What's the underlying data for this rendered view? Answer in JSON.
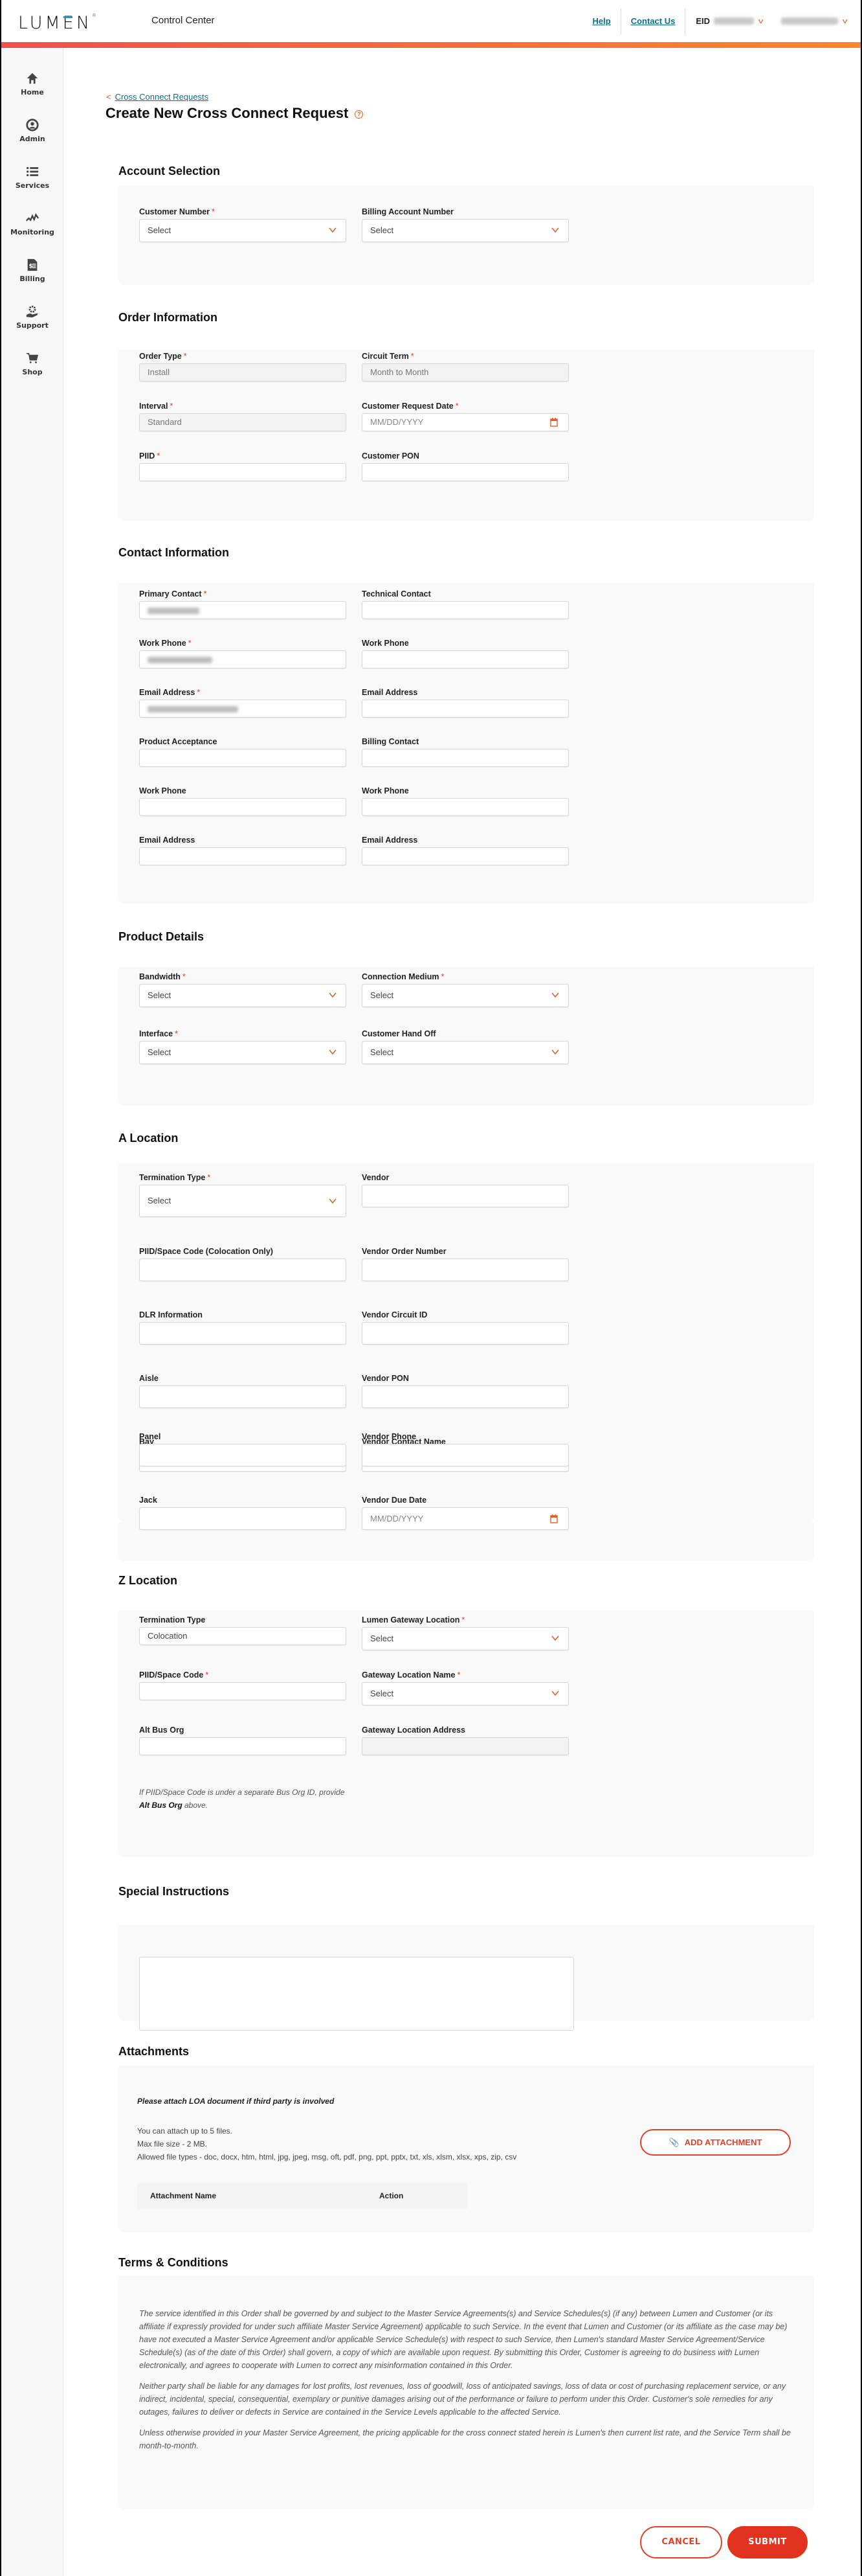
{
  "header": {
    "logo": "LUMEN",
    "app_title": "Control Center",
    "links": [
      "Help",
      "Contact Us"
    ],
    "eid_label": "EID"
  },
  "colors": {
    "accent": "#e0602b",
    "brand_red": "#e0321e",
    "link": "#0c6f8a",
    "panel_bg": "#f9f9f9"
  },
  "sidebar": {
    "items": [
      {
        "label": "Home",
        "icon": "home-icon"
      },
      {
        "label": "Admin",
        "icon": "user-circle-icon"
      },
      {
        "label": "Services",
        "icon": "list-icon"
      },
      {
        "label": "Monitoring",
        "icon": "pulse-icon"
      },
      {
        "label": "Billing",
        "icon": "invoice-icon"
      },
      {
        "label": "Support",
        "icon": "support-gear-hand-icon"
      },
      {
        "label": "Shop",
        "icon": "cart-icon"
      }
    ]
  },
  "breadcrumb": {
    "label": "Cross Connect Requests"
  },
  "page_title": "Create New Cross Connect Request",
  "sections": {
    "account": {
      "title": "Account Selection",
      "customer_number": {
        "label": "Customer Number",
        "value": "Select"
      },
      "billing_account": {
        "label": "Billing Account Number",
        "value": "Select"
      }
    },
    "order": {
      "title": "Order Information",
      "order_type": {
        "label": "Order Type",
        "value": "Install"
      },
      "circuit_term": {
        "label": "Circuit Term",
        "value": "Month to Month"
      },
      "interval": {
        "label": "Interval",
        "value": "Standard"
      },
      "request_date": {
        "label": "Customer Request Date",
        "placeholder": "MM/DD/YYYY"
      },
      "piid": {
        "label": "PIID",
        "value": ""
      },
      "customer_pon": {
        "label": "Customer PON",
        "value": ""
      }
    },
    "contact": {
      "title": "Contact Information",
      "primary_contact": {
        "label": "Primary Contact"
      },
      "technical_contact": {
        "label": "Technical Contact"
      },
      "work_phone_1": {
        "label": "Work Phone"
      },
      "work_phone_2": {
        "label": "Work Phone"
      },
      "email_1": {
        "label": "Email Address"
      },
      "email_2": {
        "label": "Email Address"
      },
      "product_acceptance": {
        "label": "Product Acceptance"
      },
      "billing_contact": {
        "label": "Billing Contact"
      },
      "work_phone_3": {
        "label": "Work Phone"
      },
      "work_phone_4": {
        "label": "Work Phone"
      },
      "email_3": {
        "label": "Email Address"
      },
      "email_4": {
        "label": "Email Address"
      }
    },
    "product": {
      "title": "Product Details",
      "bandwidth": {
        "label": "Bandwidth",
        "value": "Select"
      },
      "connection_medium": {
        "label": "Connection Medium",
        "value": "Select"
      },
      "interface": {
        "label": "Interface",
        "value": "Select"
      },
      "hand_off": {
        "label": "Customer Hand Off",
        "value": "Select"
      }
    },
    "a_location": {
      "title": "A Location",
      "termination_type": {
        "label": "Termination Type",
        "value": "Select"
      },
      "vendor": {
        "label": "Vendor"
      },
      "piid_space": {
        "label": "PIID/Space Code (Colocation Only)"
      },
      "vendor_order": {
        "label": "Vendor Order Number"
      },
      "dlr": {
        "label": "DLR Information"
      },
      "vendor_circuit": {
        "label": "Vendor Circuit ID"
      },
      "aisle": {
        "label": "Aisle"
      },
      "vendor_pon": {
        "label": "Vendor PON"
      },
      "bay": {
        "label": "Bay"
      },
      "vendor_contact": {
        "label": "Vendor Contact Name"
      },
      "panel": {
        "label": "Panel"
      },
      "vendor_phone": {
        "label": "Vendor Phone"
      },
      "jack": {
        "label": "Jack"
      },
      "vendor_due": {
        "label": "Vendor Due Date",
        "placeholder": "MM/DD/YYYY"
      }
    },
    "z_location": {
      "title": "Z Location",
      "termination_type": {
        "label": "Termination Type",
        "value": "Colocation"
      },
      "gateway_location": {
        "label": "Lumen Gateway Location",
        "value": "Select"
      },
      "piid_space": {
        "label": "PIID/Space Code"
      },
      "gateway_name": {
        "label": "Gateway Location Name",
        "value": "Select"
      },
      "alt_bus_org": {
        "label": "Alt Bus Org"
      },
      "gateway_address": {
        "label": "Gateway Location Address"
      },
      "note_pre": "If PIID/Space Code is under a separate Bus Org ID, provide ",
      "note_bold": "Alt Bus Org",
      "note_post": " above."
    },
    "special": {
      "title": "Special Instructions"
    },
    "attachments": {
      "title": "Attachments",
      "instruction": "Please attach LOA document if third party is involved",
      "info": [
        "You can attach up to 5 files.",
        "Max file size - 2 MB.",
        "Allowed file types - doc, docx, htm, html, jpg, jpeg, msg, oft, pdf, png, ppt, pptx, txt, xls, xlsm, xlsx, xps, zip, csv"
      ],
      "add_button": "ADD ATTACHMENT",
      "columns": [
        "Attachment Name",
        "Action"
      ]
    },
    "terms": {
      "title": "Terms & Conditions",
      "paragraphs": [
        "The service identified in this Order shall be governed by and subject to the Master Service Agreements(s) and Service Schedules(s) (if any) between Lumen and Customer (or its affiliate if expressly provided for under such affiliate Master Service Agreement) applicable to such Service. In the event that Lumen and Customer (or its affiliate as the case may be) have not executed a Master Service Agreement and/or applicable Service Schedule(s) with respect to such Service, then Lumen's standard Master Service Agreement/Service Schedule(s) (as of the date of this Order) shall govern, a copy of which are available upon request. By submitting this Order, Customer is agreeing to do business with Lumen electronically, and agrees to cooperate with Lumen to correct any misinformation contained in this Order.",
        "Neither party shall be liable for any damages for lost profits, lost revenues, loss of goodwill, loss of anticipated savings, loss of data or cost of purchasing replacement service, or any indirect, incidental, special, consequential, exemplary or punitive damages arising out of the performance or failure to perform under this Order. Customer's sole remedies for any outages, failures to deliver or defects in Service are contained in the Service Levels applicable to the affected Service.",
        "Unless otherwise provided in your Master Service Agreement, the pricing applicable for the cross connect stated herein is Lumen's then current list rate, and the Service Term shall be month-to-month."
      ]
    }
  },
  "actions": {
    "cancel": "CANCEL",
    "submit": "SUBMIT"
  }
}
